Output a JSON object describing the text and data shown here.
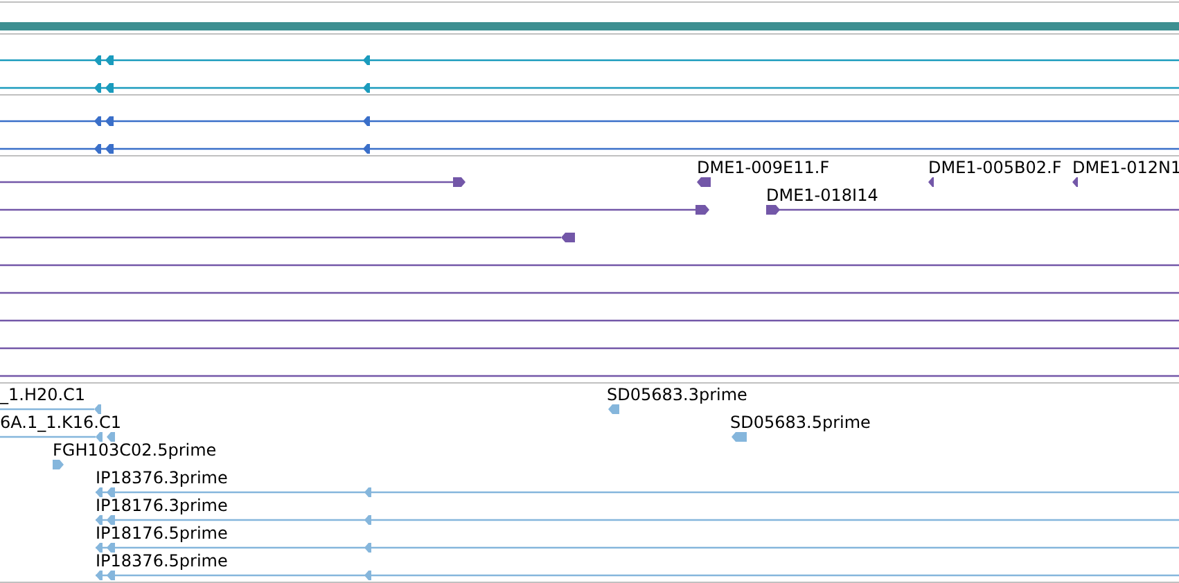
{
  "tracks": [
    {
      "kind": "bar",
      "color": "#3d8f91"
    },
    {
      "kind": "features",
      "color": "#1a9bbd",
      "rows": [
        [
          {
            "kind": "arrow",
            "reverse": true
          }
        ],
        [
          {
            "kind": "arrow",
            "reverse": true
          }
        ]
      ]
    },
    {
      "kind": "features",
      "color": "#3a6fc9",
      "rows": [
        [
          {
            "kind": "arrow",
            "reverse": true
          }
        ],
        [
          {
            "kind": "arrow",
            "reverse": true
          }
        ]
      ]
    },
    {
      "kind": "features",
      "color": "#7357a8",
      "rows": [
        [
          {
            "kind": "arrow",
            "reverse": false
          },
          {
            "kind": "arrow",
            "reverse": true,
            "label": "DME1-009E11.F"
          },
          {
            "kind": "arrow",
            "reverse": true,
            "label": "DME1-005B02.F"
          },
          {
            "kind": "arrow",
            "reverse": true,
            "label": "DME1-012N1"
          }
        ],
        [
          {
            "kind": "arrow",
            "reverse": false
          },
          {
            "kind": "arrow",
            "reverse": false,
            "label": "DME1-018I14"
          }
        ],
        [
          {
            "kind": "arrow",
            "reverse": true
          }
        ],
        [
          {
            "kind": "span"
          }
        ],
        [
          {
            "kind": "span"
          }
        ],
        [
          {
            "kind": "span"
          }
        ],
        [
          {
            "kind": "span"
          }
        ],
        [
          {
            "kind": "span"
          }
        ]
      ]
    },
    {
      "kind": "features",
      "color": "#85b6dc",
      "rows": [
        [
          {
            "kind": "arrow",
            "reverse": true,
            "label": "_1.H20.C1"
          },
          {
            "kind": "arrow",
            "reverse": true,
            "label": "SD05683.3prime"
          }
        ],
        [
          {
            "kind": "arrow",
            "reverse": true,
            "label": "6A.1_1.K16.C1"
          },
          {
            "kind": "arrow",
            "reverse": true,
            "label": "SD05683.5prime"
          }
        ],
        [
          {
            "kind": "arrow",
            "reverse": false,
            "label": "FGH103C02.5prime"
          }
        ],
        [
          {
            "kind": "arrow",
            "reverse": true,
            "label": "IP18376.3prime"
          }
        ],
        [
          {
            "kind": "arrow",
            "reverse": true,
            "label": "IP18176.3prime"
          }
        ],
        [
          {
            "kind": "arrow",
            "reverse": true,
            "label": "IP18176.5prime"
          }
        ],
        [
          {
            "kind": "arrow",
            "reverse": true,
            "label": "IP18376.5prime"
          }
        ]
      ]
    }
  ]
}
